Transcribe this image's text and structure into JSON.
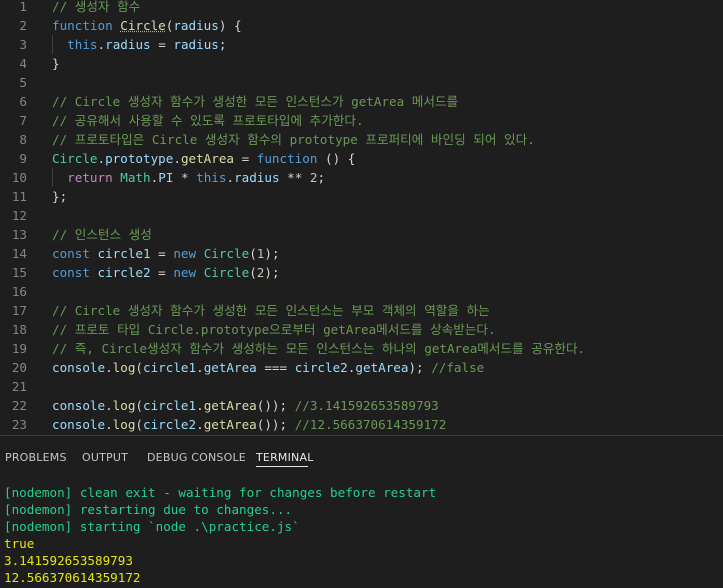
{
  "editor": {
    "lines": [
      {
        "n": "1",
        "segs": [
          {
            "t": "// 생성자 함수",
            "c": "com"
          }
        ]
      },
      {
        "n": "2",
        "segs": [
          {
            "t": "function ",
            "c": "kw"
          },
          {
            "t": "Circle",
            "c": "fn",
            "sq": true
          },
          {
            "t": "(",
            "c": "txt"
          },
          {
            "t": "radius",
            "c": "var"
          },
          {
            "t": ") {",
            "c": "txt"
          }
        ]
      },
      {
        "n": "3",
        "segs": [
          {
            "t": "  ",
            "c": "txt"
          },
          {
            "t": "this",
            "c": "kw"
          },
          {
            "t": ".",
            "c": "txt"
          },
          {
            "t": "radius",
            "c": "var"
          },
          {
            "t": " = ",
            "c": "txt"
          },
          {
            "t": "radius",
            "c": "var"
          },
          {
            "t": ";",
            "c": "txt"
          }
        ]
      },
      {
        "n": "4",
        "segs": [
          {
            "t": "}",
            "c": "txt"
          }
        ]
      },
      {
        "n": "5",
        "segs": []
      },
      {
        "n": "6",
        "segs": [
          {
            "t": "// Circle 생성자 함수가 생성한 모든 인스턴스가 getArea 메서드를",
            "c": "com"
          }
        ]
      },
      {
        "n": "7",
        "segs": [
          {
            "t": "// 공유해서 사용할 수 있도록 프로토타입에 추가한다.",
            "c": "com"
          }
        ]
      },
      {
        "n": "8",
        "segs": [
          {
            "t": "// 프로토타입은 Circle 생성자 함수의 prototype 프로퍼티에 바인딩 되어 있다.",
            "c": "com"
          }
        ]
      },
      {
        "n": "9",
        "segs": [
          {
            "t": "Circle",
            "c": "cls"
          },
          {
            "t": ".",
            "c": "txt"
          },
          {
            "t": "prototype",
            "c": "var"
          },
          {
            "t": ".",
            "c": "txt"
          },
          {
            "t": "getArea",
            "c": "fn"
          },
          {
            "t": " = ",
            "c": "txt"
          },
          {
            "t": "function",
            "c": "kw"
          },
          {
            "t": " () {",
            "c": "txt"
          }
        ]
      },
      {
        "n": "10",
        "segs": [
          {
            "t": "  ",
            "c": "txt"
          },
          {
            "t": "return",
            "c": "kw2"
          },
          {
            "t": " ",
            "c": "txt"
          },
          {
            "t": "Math",
            "c": "cls"
          },
          {
            "t": ".",
            "c": "txt"
          },
          {
            "t": "PI",
            "c": "var"
          },
          {
            "t": " * ",
            "c": "txt"
          },
          {
            "t": "this",
            "c": "kw"
          },
          {
            "t": ".",
            "c": "txt"
          },
          {
            "t": "radius",
            "c": "var"
          },
          {
            "t": " ** ",
            "c": "txt"
          },
          {
            "t": "2",
            "c": "num"
          },
          {
            "t": ";",
            "c": "txt"
          }
        ]
      },
      {
        "n": "11",
        "segs": [
          {
            "t": "};",
            "c": "txt"
          }
        ]
      },
      {
        "n": "12",
        "segs": []
      },
      {
        "n": "13",
        "segs": [
          {
            "t": "// 인스턴스 생성",
            "c": "com"
          }
        ]
      },
      {
        "n": "14",
        "segs": [
          {
            "t": "const",
            "c": "kw"
          },
          {
            "t": " ",
            "c": "txt"
          },
          {
            "t": "circle1",
            "c": "var"
          },
          {
            "t": " = ",
            "c": "txt"
          },
          {
            "t": "new",
            "c": "kw"
          },
          {
            "t": " ",
            "c": "txt"
          },
          {
            "t": "Circle",
            "c": "cls"
          },
          {
            "t": "(",
            "c": "txt"
          },
          {
            "t": "1",
            "c": "num"
          },
          {
            "t": ");",
            "c": "txt"
          }
        ]
      },
      {
        "n": "15",
        "segs": [
          {
            "t": "const",
            "c": "kw"
          },
          {
            "t": " ",
            "c": "txt"
          },
          {
            "t": "circle2",
            "c": "var"
          },
          {
            "t": " = ",
            "c": "txt"
          },
          {
            "t": "new",
            "c": "kw"
          },
          {
            "t": " ",
            "c": "txt"
          },
          {
            "t": "Circle",
            "c": "cls"
          },
          {
            "t": "(",
            "c": "txt"
          },
          {
            "t": "2",
            "c": "num"
          },
          {
            "t": ");",
            "c": "txt"
          }
        ]
      },
      {
        "n": "16",
        "segs": []
      },
      {
        "n": "17",
        "segs": [
          {
            "t": "// Circle 생성자 함수가 생성한 모든 인스턴스는 부모 객체의 역할을 하는",
            "c": "com"
          }
        ]
      },
      {
        "n": "18",
        "segs": [
          {
            "t": "// 프로토 타입 Circle.prototype으로부터 getArea메서드를 상속받는다.",
            "c": "com"
          }
        ]
      },
      {
        "n": "19",
        "segs": [
          {
            "t": "// 즉, Circle생성자 함수가 생성하는 모든 인스턴스는 하나의 getArea메서드를 공유한다.",
            "c": "com"
          }
        ]
      },
      {
        "n": "20",
        "segs": [
          {
            "t": "console",
            "c": "var"
          },
          {
            "t": ".",
            "c": "txt"
          },
          {
            "t": "log",
            "c": "fn"
          },
          {
            "t": "(",
            "c": "txt"
          },
          {
            "t": "circle1",
            "c": "var"
          },
          {
            "t": ".",
            "c": "txt"
          },
          {
            "t": "getArea",
            "c": "var"
          },
          {
            "t": " === ",
            "c": "txt"
          },
          {
            "t": "circle2",
            "c": "var"
          },
          {
            "t": ".",
            "c": "txt"
          },
          {
            "t": "getArea",
            "c": "var"
          },
          {
            "t": "); ",
            "c": "txt"
          },
          {
            "t": "//false",
            "c": "com"
          }
        ]
      },
      {
        "n": "21",
        "segs": []
      },
      {
        "n": "22",
        "segs": [
          {
            "t": "console",
            "c": "var"
          },
          {
            "t": ".",
            "c": "txt"
          },
          {
            "t": "log",
            "c": "fn"
          },
          {
            "t": "(",
            "c": "txt"
          },
          {
            "t": "circle1",
            "c": "var"
          },
          {
            "t": ".",
            "c": "txt"
          },
          {
            "t": "getArea",
            "c": "fn"
          },
          {
            "t": "()); ",
            "c": "txt"
          },
          {
            "t": "//3.141592653589793",
            "c": "com"
          }
        ]
      },
      {
        "n": "23",
        "segs": [
          {
            "t": "console",
            "c": "var"
          },
          {
            "t": ".",
            "c": "txt"
          },
          {
            "t": "log",
            "c": "fn"
          },
          {
            "t": "(",
            "c": "txt"
          },
          {
            "t": "circle2",
            "c": "var"
          },
          {
            "t": ".",
            "c": "txt"
          },
          {
            "t": "getArea",
            "c": "fn"
          },
          {
            "t": "()); ",
            "c": "txt"
          },
          {
            "t": "//12.566370614359172",
            "c": "com"
          }
        ]
      }
    ]
  },
  "panel": {
    "tabs": [
      {
        "label": "PROBLEMS"
      },
      {
        "label": "OUTPUT"
      },
      {
        "label": "DEBUG CONSOLE"
      },
      {
        "label": "TERMINAL",
        "active": true
      }
    ]
  },
  "terminal": {
    "lines": [
      {
        "t": "[nodemon] clean exit - waiting for changes before restart",
        "c": "green"
      },
      {
        "t": "[nodemon] restarting due to changes...",
        "c": "green"
      },
      {
        "t": "[nodemon] starting `node .\\practice.js`",
        "c": "green"
      },
      {
        "t": "true",
        "c": "yellow"
      },
      {
        "t": "3.141592653589793",
        "c": "yellow"
      },
      {
        "t": "12.566370614359172",
        "c": "yellow"
      }
    ]
  },
  "colors": {
    "background": "#1e1e1e",
    "comment": "#6a9955",
    "keyword": "#569cd6",
    "function": "#dcdcaa",
    "class": "#4ec9b0",
    "variable": "#9cdcfe",
    "terminal_green": "#23d18b",
    "terminal_yellow": "#e5e510"
  }
}
